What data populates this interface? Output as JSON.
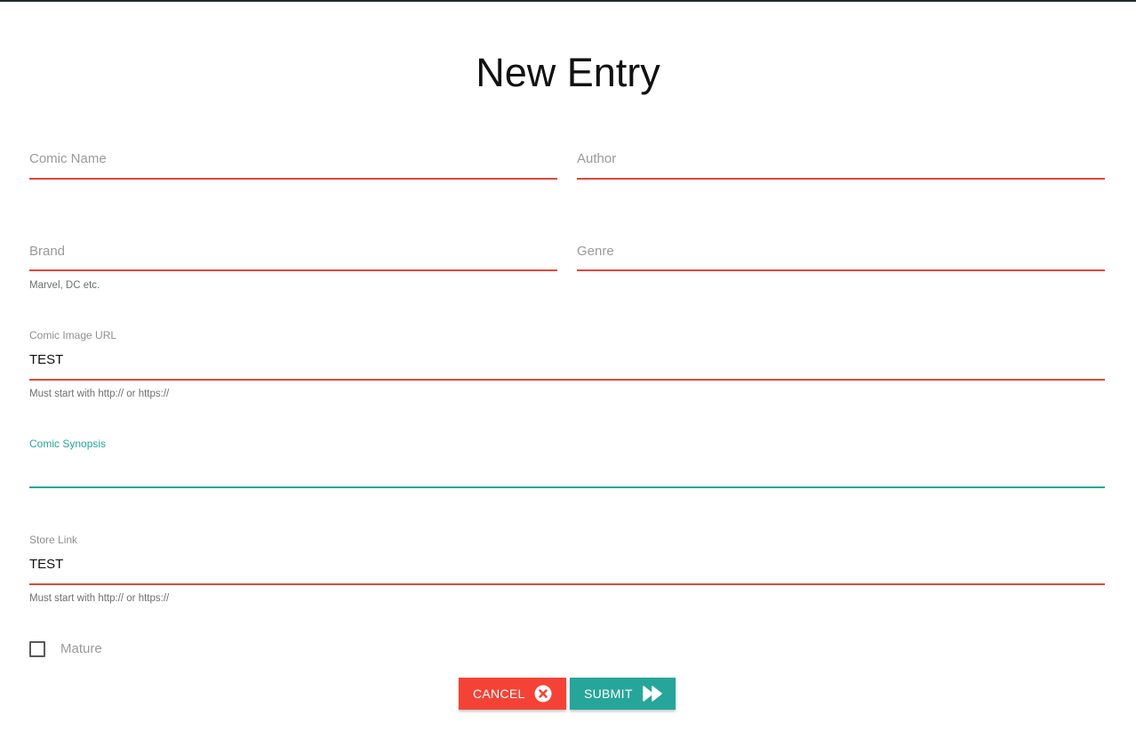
{
  "page": {
    "title": "New Entry"
  },
  "form": {
    "comic_name": {
      "placeholder": "Comic Name",
      "value": ""
    },
    "author": {
      "placeholder": "Author",
      "value": ""
    },
    "brand": {
      "placeholder": "Brand",
      "value": "",
      "helper": "Marvel, DC etc."
    },
    "genre": {
      "placeholder": "Genre",
      "value": ""
    },
    "image_url": {
      "label": "Comic Image URL",
      "value": "TEST",
      "helper": "Must start with http:// or https://"
    },
    "synopsis": {
      "label": "Comic Synopsis",
      "value": ""
    },
    "store_link": {
      "label": "Store Link",
      "value": "TEST",
      "helper": "Must start with http:// or https://"
    },
    "mature": {
      "label": "Mature",
      "checked": false
    }
  },
  "actions": {
    "cancel_label": "CANCEL",
    "submit_label": "SUBMIT"
  },
  "colors": {
    "invalid_underline": "#e0483b",
    "focus_teal": "#26a69a",
    "cancel_button": "#f44336",
    "submit_button": "#26a69a"
  },
  "icons": {
    "cancel": "close-circle-icon",
    "submit": "fast-forward-icon"
  }
}
